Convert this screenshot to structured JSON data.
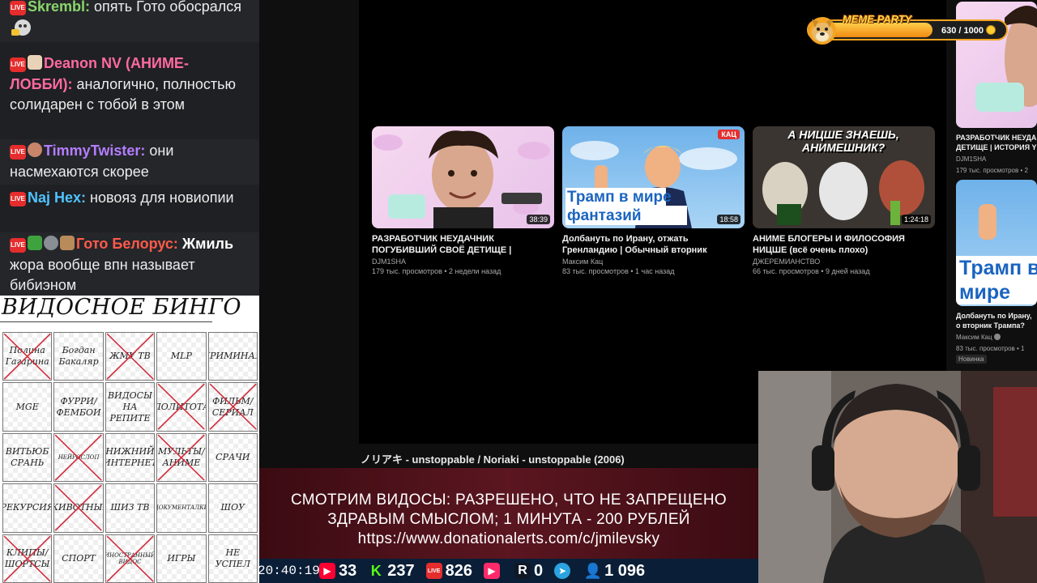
{
  "chat": {
    "messages": [
      {
        "nick": "Skrembl",
        "nick_color": "#8ad66a",
        "text": "опять Гото обосрался"
      },
      {
        "nick": "Deanon NV (АНИМЕ-ЛОББИ)",
        "nick_color": "#ff6aa0",
        "text": "аналогично, полностью солидарен с тобой в этом"
      },
      {
        "nick": "TimmyTwister",
        "nick_color": "#b57dff",
        "text": "они насмехаются скорее"
      },
      {
        "nick": "Naj Hex",
        "nick_color": "#4fc3ff",
        "text": "новояз для новиопии"
      },
      {
        "nick": "Гото Белорус",
        "nick_color": "#ff5a4a",
        "text_bold": "Жмиль",
        "text": "жора вообще впн называет бибиэном"
      }
    ]
  },
  "bingo": {
    "title": "ВИДОСНОЕ БИНГО",
    "cells": [
      {
        "label": "Полина Гагарина",
        "crossed": true,
        "small": false
      },
      {
        "label": "Богдан Бакаляр",
        "crossed": false,
        "small": false
      },
      {
        "label": "ЖМУ ТВ",
        "crossed": true,
        "small": false
      },
      {
        "label": "MLP",
        "crossed": false,
        "small": false
      },
      {
        "label": "КРИМИНАЛ",
        "crossed": false,
        "small": false
      },
      {
        "label": "MGE",
        "crossed": false,
        "small": false
      },
      {
        "label": "ФУРРИ/ ФЕМБОИ",
        "crossed": false,
        "small": false
      },
      {
        "label": "ВИДОСЫ НА РЕПИТЕ",
        "crossed": false,
        "small": false
      },
      {
        "label": "ПОЛИТОТА",
        "crossed": true,
        "small": false
      },
      {
        "label": "ФИЛЬМ/ СЕРИАЛ",
        "crossed": true,
        "small": false
      },
      {
        "label": "ВИТЬЮБ СРАНЬ",
        "crossed": false,
        "small": false
      },
      {
        "label": "НЕЙРОСЛОП",
        "crossed": true,
        "small": true
      },
      {
        "label": "НИЖНИЙ ИНТЕРНЕТ",
        "crossed": false,
        "small": false
      },
      {
        "label": "МУЛЬТЫ/ АНИМЕ",
        "crossed": true,
        "small": false
      },
      {
        "label": "СРАЧИ",
        "crossed": false,
        "small": false
      },
      {
        "label": "РЕКУРСИЯ",
        "crossed": false,
        "small": false
      },
      {
        "label": "ЖИВОТНЫЕ",
        "crossed": true,
        "small": false
      },
      {
        "label": "ШИЗ ТВ",
        "crossed": false,
        "small": false
      },
      {
        "label": "ДОКУМЕНТАЛКИ",
        "crossed": false,
        "small": true
      },
      {
        "label": "ШОУ",
        "crossed": false,
        "small": false
      },
      {
        "label": "КЛИПЫ/ ШОРТСЫ",
        "crossed": true,
        "small": false
      },
      {
        "label": "СПОРТ",
        "crossed": false,
        "small": false
      },
      {
        "label": "ИНОСТРАННЫЙ ВИДОС",
        "crossed": true,
        "small": true
      },
      {
        "label": "ИГРЫ",
        "crossed": false,
        "small": false
      },
      {
        "label": "НЕ УСПЕЛ",
        "crossed": false,
        "small": false
      }
    ]
  },
  "videos": [
    {
      "title": "РАЗРАБОТЧИК НЕУДАЧНИК ПОГУБИВШИЙ СВОЁ ДЕТИЩЕ | ИСТОРИ...",
      "channel": "DJM1SHA",
      "meta": "179 тыс. просмотров • 2 недели назад",
      "duration": "38:39"
    },
    {
      "title": "Долбануть по Ирану, отжать Гренландию | Обычный вторник Трампа? (English...",
      "channel": "Максим Кац",
      "meta": "83 тыс. просмотров • 1 час назад",
      "duration": "18:58",
      "thumb_text": "Трамп в мире фантазий",
      "thumb_badge": "КАЦ"
    },
    {
      "title": "АНИМЕ БЛОГЕРЫ И ФИЛОСОФИЯ НИЦШЕ (всё очень плохо)",
      "channel": "ДЖЕРЕМИАНСТВО",
      "meta": "66 тыс. просмотров • 9 дней назад",
      "duration": "1:24:18",
      "thumb_text": "А НИЦШЕ ЗНАЕШЬ, АНИМЕШНИК?"
    }
  ],
  "side": {
    "v1": {
      "title": "РАЗРАБОТЧИК НЕУДА ДЕТИЩЕ | ИСТОРИЯ Y",
      "channel": "DJM1SHA",
      "meta": "179 тыс. просмотров • 2"
    },
    "v2": {
      "title": "Долбануть по Ирану, о вторник Трампа? (Eng",
      "channel": "Максим Кац",
      "meta": "83 тыс. просмотров • 1",
      "badge": "Новинка",
      "thumb_text": "Трамп в мире"
    }
  },
  "now_playing": "ノリアキ - unstoppable / Noriaki - unstoppable (2006)",
  "meme_party": {
    "title": "MEME PARTY",
    "current": 630,
    "max": 1000,
    "count_text": "630 / 1000"
  },
  "banner": {
    "line1": "СМОТРИМ ВИДОСЫ: РАЗРЕШЕНО, ЧТО НЕ ЗАПРЕЩЕНО",
    "line2": "ЗДРАВЫМ СМЫСЛОМ; 1 МИНУТА - 200 РУБЛЕЙ",
    "line3": "https://www.donationalerts.com/c/jmilevsky"
  },
  "stats": {
    "clock": "20:40:19",
    "youtube": "33",
    "kick": "237",
    "live": "826",
    "rutube": "0",
    "telegram": "",
    "viewers": "1 096"
  },
  "colors": {
    "accent_red": "#e52d2d",
    "youtube_red": "#ff0033",
    "kick_green": "#53fc18",
    "telegram_blue": "#2aa3e0",
    "meme_orange": "#f4a422"
  }
}
